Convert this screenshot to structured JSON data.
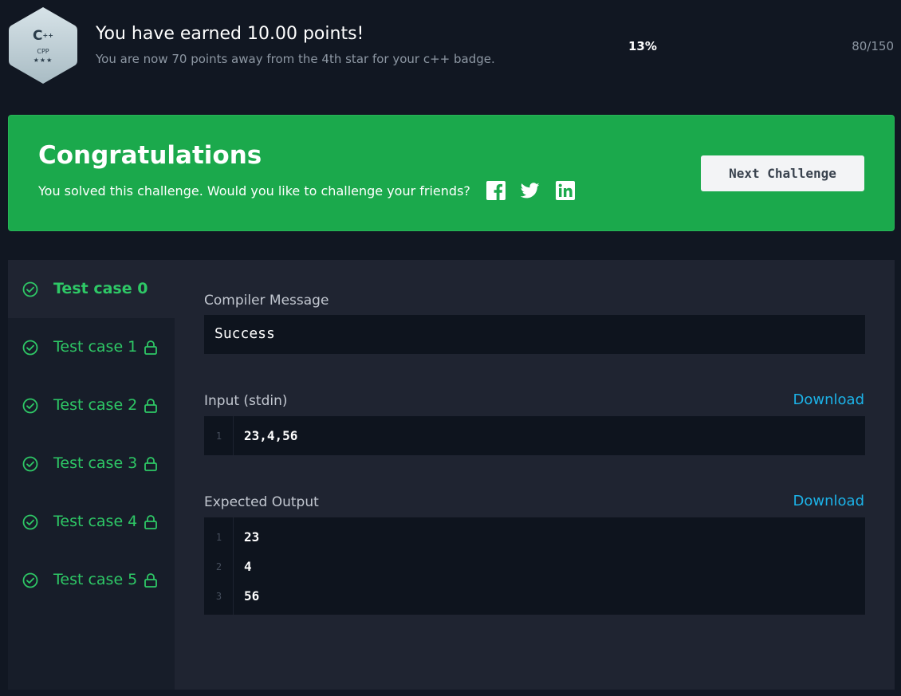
{
  "points": {
    "badge_lang": "C",
    "badge_lang_suffix": "++",
    "badge_code": "CPP",
    "badge_stars": "★★★",
    "title": "You have earned 10.00 points!",
    "subtitle": "You are now 70 points away from the 4th star for your c++ badge.",
    "percent": "13%",
    "count": "80/150"
  },
  "banner": {
    "title": "Congratulations",
    "text": "You solved this challenge. Would you like to challenge your friends?",
    "share_icons": [
      "facebook-icon",
      "twitter-icon",
      "linkedin-icon"
    ],
    "next_label": "Next Challenge",
    "color": "#1ba94c"
  },
  "tests": {
    "items": [
      {
        "label": "Test case 0",
        "locked": false,
        "active": true
      },
      {
        "label": "Test case 1",
        "locked": true,
        "active": false
      },
      {
        "label": "Test case 2",
        "locked": true,
        "active": false
      },
      {
        "label": "Test case 3",
        "locked": true,
        "active": false
      },
      {
        "label": "Test case 4",
        "locked": true,
        "active": false
      },
      {
        "label": "Test case 5",
        "locked": true,
        "active": false
      }
    ],
    "pass_color": "#2ec866"
  },
  "result": {
    "compiler_label": "Compiler Message",
    "compiler_message": "Success",
    "input_label": "Input (stdin)",
    "input_download": "Download",
    "input_lines": [
      {
        "num": "1",
        "text": "23,4,56"
      }
    ],
    "output_label": "Expected Output",
    "output_download": "Download",
    "output_lines": [
      {
        "num": "1",
        "text": "23"
      },
      {
        "num": "2",
        "text": "4"
      },
      {
        "num": "3",
        "text": "56"
      }
    ],
    "link_color": "#1cb3e8"
  }
}
